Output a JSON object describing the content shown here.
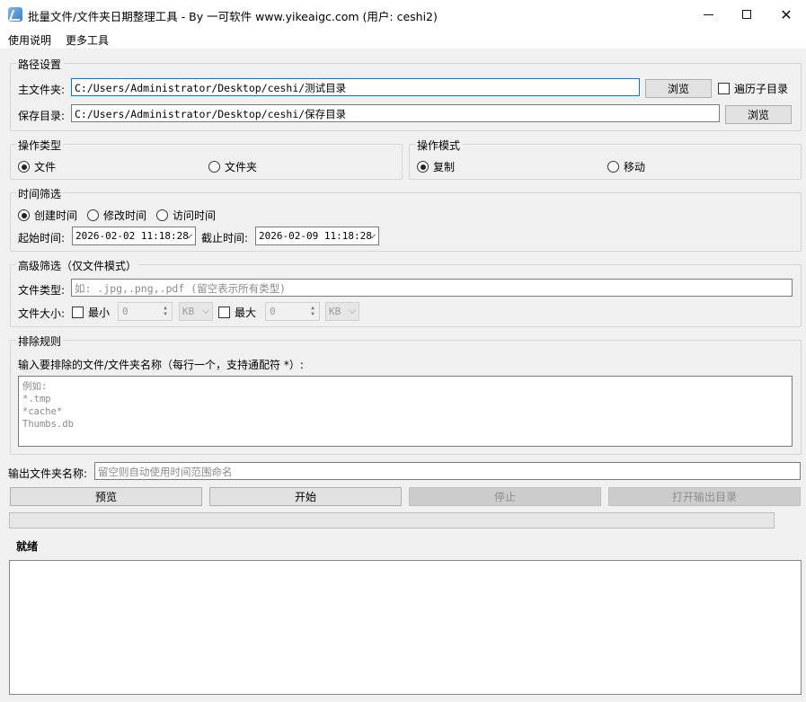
{
  "window": {
    "title": "批量文件/文件夹日期整理工具 - By 一可软件 www.yikeaigc.com (用户: ceshi2)"
  },
  "menu": {
    "items": [
      "使用说明",
      "更多工具"
    ]
  },
  "path": {
    "group_title": "路径设置",
    "source_label": "主文件夹:",
    "source_value": "C:/Users/Administrator/Desktop/ceshi/测试目录",
    "source_browse": "浏览",
    "recursive_label": "遍历子目录",
    "recursive_checked": false,
    "dest_label": "保存目录:",
    "dest_value": "C:/Users/Administrator/Desktop/ceshi/保存目录",
    "dest_browse": "浏览"
  },
  "op_type": {
    "group_title": "操作类型",
    "options": [
      "文件",
      "文件夹"
    ],
    "selected": "文件"
  },
  "op_mode": {
    "group_title": "操作模式",
    "options": [
      "复制",
      "移动"
    ],
    "selected": "复制"
  },
  "time_filter": {
    "group_title": "时间筛选",
    "options": [
      "创建时间",
      "修改时间",
      "访问时间"
    ],
    "selected": "创建时间",
    "start_label": "起始时间:",
    "start_value": "2026-02-02 11:18:28",
    "end_label": "截止时间:",
    "end_value": "2026-02-09 11:18:28"
  },
  "advanced": {
    "group_title": "高级筛选（仅文件模式）",
    "type_label": "文件类型:",
    "type_placeholder": "如: .jpg,.png,.pdf (留空表示所有类型)",
    "size_label": "文件大小:",
    "min_label": "最小",
    "min_value": "0",
    "min_unit": "KB",
    "max_label": "最大",
    "max_value": "0",
    "max_unit": "KB"
  },
  "exclude": {
    "group_title": "排除规则",
    "instruction": "输入要排除的文件/文件夹名称（每行一个，支持通配符 *）:",
    "placeholder_lines": [
      "例如:",
      "*.tmp",
      "*cache*",
      "Thumbs.db"
    ]
  },
  "output": {
    "label": "输出文件夹名称:",
    "placeholder": "留空则自动使用时间范围命名"
  },
  "actions": {
    "preview": "预览",
    "start": "开始",
    "stop": "停止",
    "open_output": "打开输出目录"
  },
  "status": {
    "text": "就绪",
    "progress": 0
  }
}
